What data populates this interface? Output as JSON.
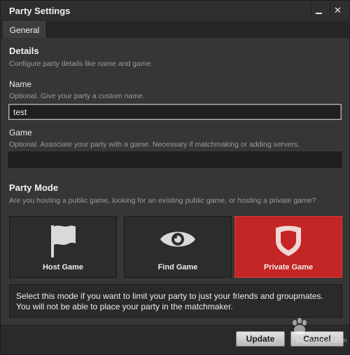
{
  "window": {
    "title": "Party Settings",
    "minimize_icon": "minimize-icon",
    "close_icon": "close-icon",
    "close_glyph": "✕"
  },
  "tabs": [
    {
      "label": "General",
      "selected": true
    }
  ],
  "details": {
    "heading": "Details",
    "description": "Configure party details like name and game."
  },
  "name_field": {
    "label": "Name",
    "hint": "Optional. Give your party a custom name.",
    "value": "test"
  },
  "game_field": {
    "label": "Game",
    "hint": "Optional. Associate your party with a game. Necessary if matchmaking or adding servers.",
    "value": ""
  },
  "party_mode": {
    "heading": "Party Mode",
    "description": "Are you hosting a public game, looking for an existing public game, or hosting a private game?",
    "modes": [
      {
        "label": "Host Game",
        "icon": "flag-icon",
        "selected": false
      },
      {
        "label": "Find Game",
        "icon": "eye-icon",
        "selected": false
      },
      {
        "label": "Private Game",
        "icon": "shield-icon",
        "selected": true
      }
    ],
    "selected_description": "Select this mode if you want to limit your party to just your friends and groupmates. You will not be able to place your party in the matchmaker."
  },
  "buttons": {
    "update": "Update",
    "cancel": "Cancel"
  },
  "colors": {
    "selected_mode": "#c42525",
    "background": "#363636"
  },
  "watermark": {
    "text": "jingyan.baidu.com"
  }
}
